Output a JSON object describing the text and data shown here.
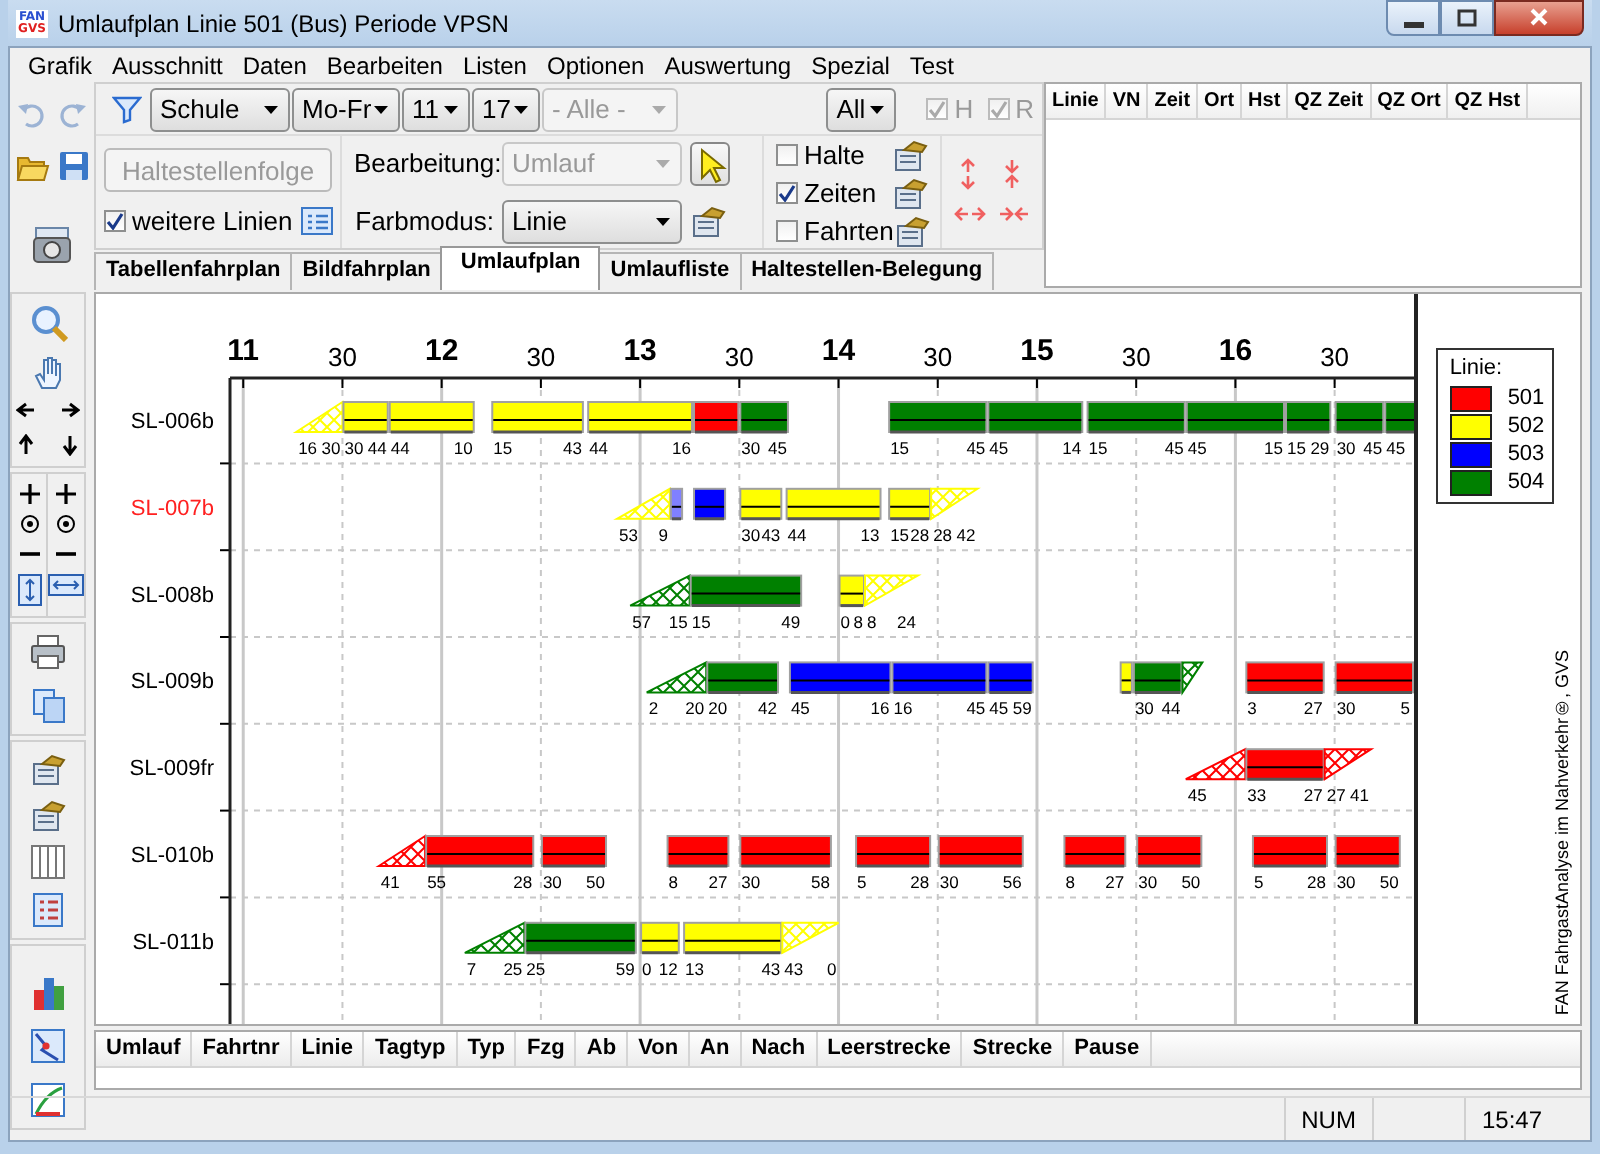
{
  "window": {
    "title": "Umlaufplan Linie 501 (Bus) Periode VPSN",
    "logo_lines": [
      "FAN",
      "GVS"
    ]
  },
  "menu": [
    "Grafik",
    "Ausschnitt",
    "Daten",
    "Bearbeiten",
    "Listen",
    "Optionen",
    "Auswertung",
    "Spezial",
    "Test"
  ],
  "filter": {
    "dropdowns": [
      {
        "value": "Schule",
        "disabled": false
      },
      {
        "value": "Mo-Fr",
        "disabled": false
      },
      {
        "value": "11",
        "disabled": false
      },
      {
        "value": "17",
        "disabled": false
      },
      {
        "value": "- Alle -",
        "disabled": true
      }
    ],
    "scope": {
      "value": "All",
      "disabled": false
    },
    "flags": [
      {
        "label": "H",
        "checked": true,
        "disabled": true
      },
      {
        "label": "R",
        "checked": true,
        "disabled": true
      }
    ]
  },
  "stop_sequence": {
    "button": {
      "label": "Haltestellenfolge",
      "disabled": true
    },
    "more_lines": {
      "label": "weitere Linien",
      "checked": true
    }
  },
  "editing": [
    {
      "label": "Bearbeitung:",
      "value": "Umlauf",
      "disabled": true,
      "kind": "cursor"
    },
    {
      "label": "Farbmodus:",
      "value": "Linie",
      "disabled": false,
      "kind": "export"
    }
  ],
  "display_options": [
    {
      "label": "Halte",
      "checked": false
    },
    {
      "label": "Zeiten",
      "checked": true
    },
    {
      "label": "Fahrten",
      "checked": false
    }
  ],
  "detail_table": {
    "columns": [
      "Linie",
      "VN",
      "Zeit",
      "Ort",
      "Hst",
      "QZ Zeit",
      "QZ Ort",
      "QZ Hst"
    ]
  },
  "tabs": [
    {
      "label": "Tabellenfahrplan",
      "selected": false
    },
    {
      "label": "Bildfahrplan",
      "selected": false
    },
    {
      "label": "Umlaufplan",
      "selected": true
    },
    {
      "label": "Umlaufliste",
      "selected": false
    },
    {
      "label": "Haltestellen-Belegung",
      "selected": false
    }
  ],
  "chart": {
    "axis_labels": [
      {
        "text": "11",
        "major": true
      },
      {
        "text": "30",
        "major": false
      },
      {
        "text": "12",
        "major": true
      },
      {
        "text": "30",
        "major": false
      },
      {
        "text": "13",
        "major": true
      },
      {
        "text": "30",
        "major": false
      },
      {
        "text": "14",
        "major": true
      },
      {
        "text": "30",
        "major": false
      },
      {
        "text": "15",
        "major": true
      },
      {
        "text": "30",
        "major": false
      },
      {
        "text": "16",
        "major": true
      },
      {
        "text": "30",
        "major": false
      }
    ],
    "rows": [
      {
        "label": "SL-006b",
        "highlighted": false,
        "blocks": [
          {
            "kind": "lead_in",
            "color": "#ffff00",
            "start_label": "16",
            "end_label": "30"
          },
          {
            "kind": "trip",
            "color": "#ffff00",
            "start_label": "30",
            "end_label": "44"
          },
          {
            "kind": "trip",
            "color": "#ffff00",
            "start_label": "44",
            "end_label": "10"
          },
          {
            "kind": "trip",
            "color": "#ffff00",
            "start_label": "15",
            "end_label": "43"
          },
          {
            "kind": "trip",
            "color": "#ffff00",
            "start_label": "44",
            "end_label": "16"
          },
          {
            "kind": "trip",
            "color": "#ff0000"
          },
          {
            "kind": "trip",
            "color": "#008000",
            "start_label": "30",
            "end_label": "45"
          },
          {
            "kind": "trip",
            "color": "#008000",
            "start_label": "15",
            "end_label": "45"
          },
          {
            "kind": "trip",
            "color": "#008000",
            "start_label": "45",
            "end_label": "14"
          },
          {
            "kind": "trip",
            "color": "#008000",
            "start_label": "15",
            "end_label": "45"
          },
          {
            "kind": "trip",
            "color": "#008000",
            "start_label": "45",
            "end_label": "15"
          },
          {
            "kind": "trip",
            "color": "#008000",
            "start_label": "15",
            "end_label": "29"
          },
          {
            "kind": "trip",
            "color": "#008000",
            "start_label": "30",
            "end_label": "45"
          },
          {
            "kind": "trip",
            "color": "#008000",
            "start_label": "45"
          }
        ]
      },
      {
        "label": "SL-007b",
        "highlighted": true,
        "blocks": [
          {
            "kind": "lead_in",
            "color": "#ffff00",
            "start_label": "53",
            "end_label": "9"
          },
          {
            "kind": "trip",
            "color": "#8080ff"
          },
          {
            "kind": "trip",
            "color": "#0000ff"
          },
          {
            "kind": "trip",
            "color": "#ffff00",
            "start_label": "30",
            "end_label": "43"
          },
          {
            "kind": "trip",
            "color": "#ffff00",
            "start_label": "44",
            "end_label": "13"
          },
          {
            "kind": "trip",
            "color": "#ffff00",
            "start_label": "15",
            "end_label": "28"
          },
          {
            "kind": "lead_out",
            "color": "#ffff00",
            "start_label": "28",
            "end_label": "42"
          }
        ]
      },
      {
        "label": "SL-008b",
        "highlighted": false,
        "blocks": [
          {
            "kind": "lead_in",
            "color": "#008000",
            "start_label": "57",
            "end_label": "15"
          },
          {
            "kind": "trip",
            "color": "#008000",
            "start_label": "15",
            "end_label": "49"
          },
          {
            "kind": "trip",
            "color": "#ffff00",
            "start_label": "0",
            "end_label": "8"
          },
          {
            "kind": "lead_out",
            "color": "#ffff00",
            "start_label": "8",
            "end_label": "24"
          }
        ]
      },
      {
        "label": "SL-009b",
        "highlighted": false,
        "blocks": [
          {
            "kind": "lead_in",
            "color": "#008000",
            "start_label": "2",
            "end_label": "20"
          },
          {
            "kind": "trip",
            "color": "#008000",
            "start_label": "20",
            "end_label": "42"
          },
          {
            "kind": "trip",
            "color": "#0000ff",
            "start_label": "45",
            "end_label": "16"
          },
          {
            "kind": "trip",
            "color": "#0000ff",
            "start_label": "16",
            "end_label": "45"
          },
          {
            "kind": "trip",
            "color": "#0000ff",
            "start_label": "45",
            "end_label": "59"
          },
          {
            "kind": "trip",
            "color": "#ffff00"
          },
          {
            "kind": "trip",
            "color": "#008000",
            "start_label": "30",
            "end_label": "44"
          },
          {
            "kind": "lead_out",
            "color": "#008000"
          },
          {
            "kind": "trip",
            "color": "#ff0000",
            "start_label": "3",
            "end_label": "27"
          },
          {
            "kind": "trip",
            "color": "#ff0000",
            "start_label": "30",
            "end_label": "5"
          }
        ]
      },
      {
        "label": "SL-009fr",
        "highlighted": false,
        "blocks": [
          {
            "kind": "lead_in",
            "color": "#ff0000",
            "start_label": "45"
          },
          {
            "kind": "trip",
            "color": "#ff0000",
            "start_label": "33",
            "end_label": "27"
          },
          {
            "kind": "lead_out",
            "color": "#ff0000",
            "start_label": "27",
            "end_label": "41"
          }
        ]
      },
      {
        "label": "SL-010b",
        "highlighted": false,
        "blocks": [
          {
            "kind": "lead_in",
            "color": "#ff0000",
            "start_label": "41"
          },
          {
            "kind": "trip",
            "color": "#ff0000",
            "start_label": "55",
            "end_label": "28"
          },
          {
            "kind": "trip",
            "color": "#ff0000",
            "start_label": "30",
            "end_label": "50"
          },
          {
            "kind": "trip",
            "color": "#ff0000",
            "start_label": "8",
            "end_label": "27"
          },
          {
            "kind": "trip",
            "color": "#ff0000",
            "start_label": "30",
            "end_label": "58"
          },
          {
            "kind": "trip",
            "color": "#ff0000",
            "start_label": "5",
            "end_label": "28"
          },
          {
            "kind": "trip",
            "color": "#ff0000",
            "start_label": "30",
            "end_label": "56"
          },
          {
            "kind": "trip",
            "color": "#ff0000",
            "start_label": "8",
            "end_label": "27"
          },
          {
            "kind": "trip",
            "color": "#ff0000",
            "start_label": "30",
            "end_label": "50"
          },
          {
            "kind": "trip",
            "color": "#ff0000",
            "start_label": "5",
            "end_label": "28"
          },
          {
            "kind": "trip",
            "color": "#ff0000",
            "start_label": "30",
            "end_label": "50"
          }
        ]
      },
      {
        "label": "SL-011b",
        "highlighted": false,
        "blocks": [
          {
            "kind": "lead_in",
            "color": "#008000",
            "start_label": "7",
            "end_label": "25"
          },
          {
            "kind": "trip",
            "color": "#008000",
            "start_label": "25",
            "end_label": "59"
          },
          {
            "kind": "trip",
            "color": "#ffff00",
            "start_label": "0",
            "end_label": "12"
          },
          {
            "kind": "trip",
            "color": "#ffff00",
            "start_label": "13",
            "end_label": "43"
          },
          {
            "kind": "lead_out",
            "color": "#ffff00",
            "start_label": "43",
            "end_label": "0"
          }
        ]
      }
    ],
    "legend": {
      "title": "Linie:",
      "items": [
        {
          "line": "501",
          "color": "#ff0000"
        },
        {
          "line": "502",
          "color": "#ffff00"
        },
        {
          "line": "503",
          "color": "#0000ff"
        },
        {
          "line": "504",
          "color": "#008000"
        }
      ]
    },
    "credit": "FAN FahrgastAnalyse im Nahverkehr®, GVS"
  },
  "trip_table": {
    "columns": [
      "Umlauf",
      "Fahrtnr",
      "Linie",
      "Tagtyp",
      "Typ",
      "Fzg",
      "Ab",
      "Von",
      "An",
      "Nach",
      "Leerstrecke",
      "Strecke",
      "Pause"
    ]
  },
  "status_bar": {
    "num_lock": "NUM",
    "time": "15:47"
  }
}
